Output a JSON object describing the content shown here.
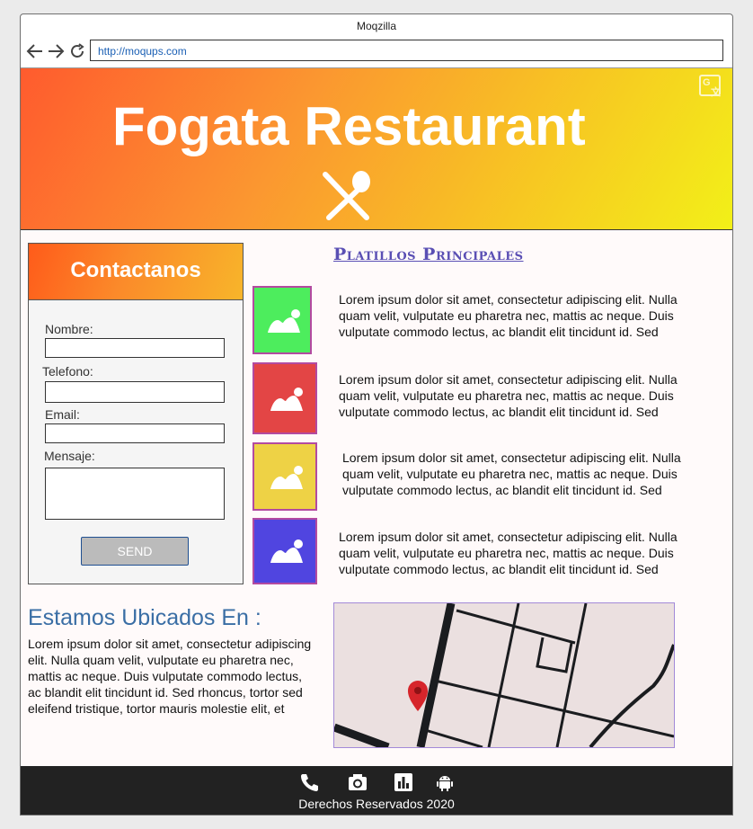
{
  "browser": {
    "title": "Moqzilla",
    "url": "http://moqups.com",
    "icons": [
      "back-arrow-icon",
      "forward-arrow-icon",
      "reload-icon"
    ]
  },
  "hero": {
    "title": "Fogata Restaurant",
    "icon": "fork-spoon-icon",
    "translate_icon": "translate-icon",
    "gradient": [
      "#ff5b2e",
      "#f2f018"
    ]
  },
  "contact": {
    "title": "Contactanos",
    "fields": [
      {
        "label": "Nombre:",
        "value": ""
      },
      {
        "label": "Telefono:",
        "value": ""
      },
      {
        "label": "Email:",
        "value": ""
      },
      {
        "label": "Mensaje:",
        "value": ""
      }
    ],
    "send_label": "SEND"
  },
  "dishes": {
    "title": "Platillos Principales",
    "items": [
      {
        "color": "#4ded5d",
        "icon": "image-placeholder-icon",
        "text": "Lorem ipsum dolor sit amet, consectetur adipiscing elit. Nulla quam velit, vulputate eu pharetra nec, mattis ac neque. Duis vulputate commodo lectus, ac blandit elit tincidunt id. Sed rhoncus, tortor sed eleifend tristique, tortor"
      },
      {
        "color": "#e34545",
        "icon": "image-placeholder-icon",
        "text": "Lorem ipsum dolor sit amet, consectetur adipiscing elit. Nulla quam velit, vulputate eu pharetra nec, mattis ac neque. Duis vulputate commodo lectus, ac blandit elit tincidunt id. Sed rhoncus, tortor sed eleifend tristique, tortor"
      },
      {
        "color": "#eed245",
        "icon": "image-placeholder-icon",
        "text": "Lorem ipsum dolor sit amet, consectetur adipiscing elit. Nulla quam velit, vulputate eu pharetra nec, mattis ac neque. Duis vulputate commodo lectus, ac blandit elit tincidunt id. Sed rhoncus, tortor sed eleifend tristique, tortor"
      },
      {
        "color": "#5045e0",
        "icon": "image-placeholder-icon",
        "text": "Lorem ipsum dolor sit amet, consectetur adipiscing elit. Nulla quam velit, vulputate eu pharetra nec, mattis ac neque. Duis vulputate commodo lectus, ac blandit elit tincidunt id. Sed rhoncus, tortor sed eleifend tristique, tortor"
      }
    ]
  },
  "location": {
    "title": "Estamos Ubicados En :",
    "text": "Lorem ipsum dolor sit amet, consectetur adipiscing elit. Nulla quam velit, vulputate eu pharetra nec, mattis ac neque. Duis vulputate commodo lectus, ac blandit elit tincidunt id. Sed rhoncus, tortor sed eleifend tristique, tortor mauris molestie elit, et lacinia ipsum quam nec dui. Quisque nec mauris",
    "map_icon": "map-pin-icon"
  },
  "footer": {
    "icons": [
      "phone-icon",
      "camera-icon",
      "bar-chart-icon",
      "android-icon"
    ],
    "text": "Derechos Reservados 2020"
  }
}
